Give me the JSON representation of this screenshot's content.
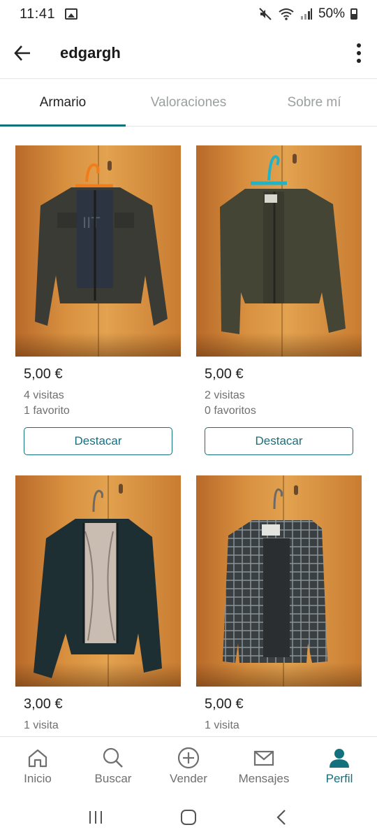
{
  "status_bar": {
    "time": "11:41",
    "battery": "50%",
    "icons": [
      "gallery-icon",
      "mute-icon",
      "wifi-icon",
      "signal-icon",
      "battery-icon"
    ]
  },
  "header": {
    "username": "edgargh",
    "back_icon": "arrow-left-icon",
    "more_icon": "more-vertical-icon"
  },
  "tabs": [
    {
      "label": "Armario",
      "active": true
    },
    {
      "label": "Valoraciones",
      "active": false
    },
    {
      "label": "Sobre mí",
      "active": false
    }
  ],
  "items": [
    {
      "price": "5,00 €",
      "visits": "4 visitas",
      "favorites": "1 favorito",
      "button": "Destacar",
      "hanger_color": "#f07d1a",
      "jacket_color": "#3b3b36"
    },
    {
      "price": "5,00 €",
      "visits": "2 visitas",
      "favorites": "0 favoritos",
      "button": "Destacar",
      "hanger_color": "#1eb3c9",
      "jacket_color": "#454536"
    },
    {
      "price": "3,00 €",
      "visits": "1 visita",
      "favorites": "",
      "button": "",
      "hanger_color": "#6a6a6a",
      "jacket_color": "#1e2f33"
    },
    {
      "price": "5,00 €",
      "visits": "1 visita",
      "favorites": "",
      "button": "",
      "hanger_color": "#6a6a6a",
      "jacket_color": "#3a3f42"
    }
  ],
  "bottom_nav": [
    {
      "label": "Inicio",
      "icon": "home-icon",
      "active": false
    },
    {
      "label": "Buscar",
      "icon": "search-icon",
      "active": false
    },
    {
      "label": "Vender",
      "icon": "plus-circle-icon",
      "active": false
    },
    {
      "label": "Mensajes",
      "icon": "mail-icon",
      "active": false
    },
    {
      "label": "Perfil",
      "icon": "user-icon",
      "active": true
    }
  ],
  "system_nav": [
    "recents-icon",
    "home-button-icon",
    "back-icon"
  ],
  "colors": {
    "accent": "#13717e",
    "text_primary": "#222222",
    "text_secondary": "#6f6f6f",
    "tab_inactive": "#9aa0a0"
  }
}
